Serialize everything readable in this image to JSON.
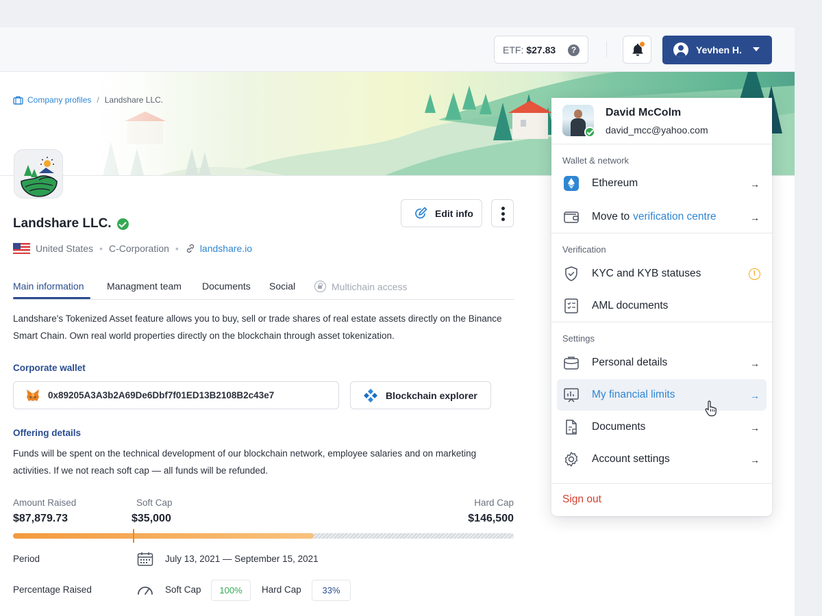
{
  "header": {
    "etf_label": "ETF:",
    "etf_value": "$27.83",
    "help_symbol": "?",
    "user_name": "Yevhen H."
  },
  "breadcrumb": {
    "parent": "Company profiles",
    "separator": "/",
    "current": "Landshare LLC."
  },
  "company": {
    "name": "Landshare LLC.",
    "country": "United States",
    "type": "C-Corporation",
    "website": "landshare.io",
    "dot": "•"
  },
  "actions": {
    "edit_label": "Edit info"
  },
  "tabs": [
    {
      "label": "Main information"
    },
    {
      "label": "Managment team"
    },
    {
      "label": "Documents"
    },
    {
      "label": "Social"
    },
    {
      "label": "Multichain access"
    }
  ],
  "main": {
    "description": "Landshare's Tokenized Asset feature allows you to buy, sell or trade shares of real estate assets directly on the Binance Smart Chain. Own real world properties directly on the blockchain through asset tokenization.",
    "wallet_title": "Corporate wallet",
    "wallet_address": "0x89205A3A3b2A69De6Dbf7f01ED13B2108B2c43e7",
    "explorer_label": "Blockchain explorer",
    "offering_title": "Offering details",
    "offering_text": "Funds will be spent on the technical development of our blockchain network, employee salaries and on marketing activities. If we not reach soft cap — all funds will be refunded."
  },
  "funding": {
    "amount_label": "Amount Raised",
    "amount_value": "$87,879.73",
    "softcap_label": "Soft Cap",
    "softcap_value": "$35,000",
    "hardcap_label": "Hard Cap",
    "hardcap_value": "$146,500",
    "progress_fraction": 0.6,
    "softcap_fraction": 0.24,
    "period_label": "Period",
    "period_value": "July 13, 2021 — September 15, 2021",
    "percentage_label": "Percentage Raised",
    "soft_cap_short": "Soft Cap",
    "soft_cap_pct": "100%",
    "hard_cap_short": "Hard Cap",
    "hard_cap_pct": "33%"
  },
  "dropdown": {
    "name": "David McColm",
    "email": "david_mcc@yahoo.com",
    "section_wallet": "Wallet & network",
    "network": "Ethereum",
    "move_prefix": "Move to",
    "move_link": "verification centre",
    "section_verification": "Verification",
    "kyc": "KYC and KYB statuses",
    "warn_symbol": "!",
    "aml": "AML documents",
    "section_settings": "Settings",
    "personal": "Personal details",
    "limits": "My financial limits",
    "documents": "Documents",
    "account": "Account settings",
    "sign_out": "Sign out",
    "arrow": "→"
  },
  "colors": {
    "primary": "#2a4c8f",
    "link": "#2f86d4",
    "success": "#34a853",
    "warning": "#f2a81d",
    "danger": "#d23f31",
    "progress": "#f39a3d"
  }
}
